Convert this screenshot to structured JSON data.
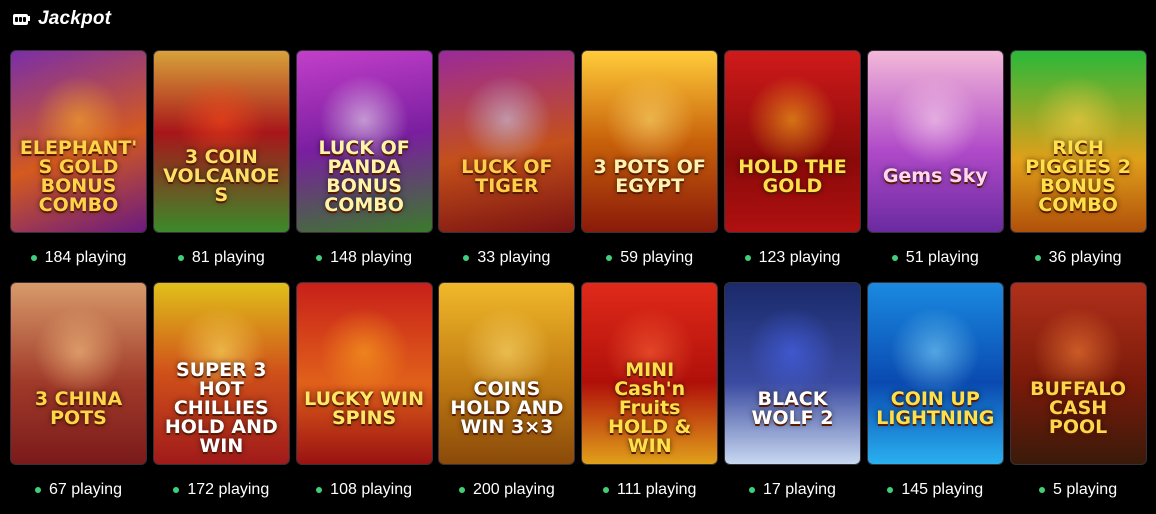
{
  "section": {
    "title": "Jackpot",
    "icon": "slot-machine-icon"
  },
  "colors": {
    "background": "#000000",
    "online_dot": "#3fd17a",
    "text": "#ffffff"
  },
  "games": [
    {
      "title": "ELEPHANT'S GOLD BONUS COMBO",
      "playing": "184 playing",
      "bg": "linear-gradient(160deg,#7a2ea8,#d45a1e 55%,#6a1a80)",
      "glow": "#ffb627",
      "text_color": "#ffd24a"
    },
    {
      "title": "3 COIN VOLCANOES",
      "playing": "81 playing",
      "bg": "linear-gradient(180deg,#d8a23a,#a8161a 45%,#3b8a2a)",
      "glow": "#ff4a16",
      "text_color": "#ffe066"
    },
    {
      "title": "LUCK OF PANDA BONUS COMBO",
      "playing": "148 playing",
      "bg": "linear-gradient(170deg,#c23fc9,#7a1ea0 50%,#3a7a2a)",
      "glow": "#f5f5f5",
      "text_color": "#fff4a8"
    },
    {
      "title": "LUCK OF TIGER",
      "playing": "33 playing",
      "bg": "linear-gradient(170deg,#9a2a9a,#c4501a 55%,#7a1212)",
      "glow": "#c8d8ff",
      "text_color": "#ffcf4a"
    },
    {
      "title": "3 POTS OF EGYPT",
      "playing": "59 playing",
      "bg": "linear-gradient(180deg,#ffcc3a,#c8610a 50%,#8a1a0a)",
      "glow": "#ffe27a",
      "text_color": "#fff2b0"
    },
    {
      "title": "HOLD THE GOLD",
      "playing": "123 playing",
      "bg": "linear-gradient(180deg,#d01a1a,#8a0a0a 60%,#b01010)",
      "glow": "#ffc41a",
      "text_color": "#ffe04a"
    },
    {
      "title": "Gems Sky",
      "playing": "51 playing",
      "bg": "linear-gradient(180deg,#f2b8d8,#b04ac8 55%,#6a2aa0)",
      "glow": "#ffe0f0",
      "text_color": "#ffd6f2"
    },
    {
      "title": "RICH PIGGIES 2 BONUS COMBO",
      "playing": "36 playing",
      "bg": "linear-gradient(180deg,#2ab83a,#e0a01a 60%,#b0500a)",
      "glow": "#ffd24a",
      "text_color": "#ffe04a"
    },
    {
      "title": "3 CHINA POTS",
      "playing": "67 playing",
      "bg": "linear-gradient(180deg,#d89a6a,#a03a2a 55%,#7a1a1a)",
      "glow": "#ffd08a",
      "text_color": "#ffd64a"
    },
    {
      "title": "SUPER 3 HOT CHILLIES HOLD AND WIN",
      "playing": "172 playing",
      "bg": "linear-gradient(180deg,#e0c01a,#d0501a 50%,#a01a1a)",
      "glow": "#ffef6a",
      "text_color": "#ffffff"
    },
    {
      "title": "LUCKY WIN SPINS",
      "playing": "108 playing",
      "bg": "linear-gradient(180deg,#c8201a,#e0601a 55%,#9a1212)",
      "glow": "#ffb020",
      "text_color": "#ffe866"
    },
    {
      "title": "COINS HOLD AND WIN 3×3",
      "playing": "200 playing",
      "bg": "linear-gradient(180deg,#f0b82a,#c07a12 55%,#8a4a0a)",
      "glow": "#ffe27a",
      "text_color": "#ffffff"
    },
    {
      "title": "MINI Cash'n Fruits HOLD & WIN",
      "playing": "111 playing",
      "bg": "linear-gradient(180deg,#e02a1a,#b0100a 55%,#e0a01a)",
      "glow": "#ff6a3a",
      "text_color": "#ffe04a"
    },
    {
      "title": "BLACK WOLF 2",
      "playing": "17 playing",
      "bg": "linear-gradient(180deg,#1a2a6a,#3a4aa0 55%,#c8d8f0)",
      "glow": "#4a6aff",
      "text_color": "#ffffff"
    },
    {
      "title": "COIN UP LIGHTNING",
      "playing": "145 playing",
      "bg": "linear-gradient(180deg,#1a8ae0,#0a4ab0 55%,#2ab0f0)",
      "glow": "#8ae0ff",
      "text_color": "#ffe04a"
    },
    {
      "title": "BUFFALO CASH POOL",
      "playing": "5 playing",
      "bg": "linear-gradient(180deg,#b0301a,#7a1a0a 55%,#3a1a0a)",
      "glow": "#ff8a3a",
      "text_color": "#ffd64a"
    }
  ]
}
